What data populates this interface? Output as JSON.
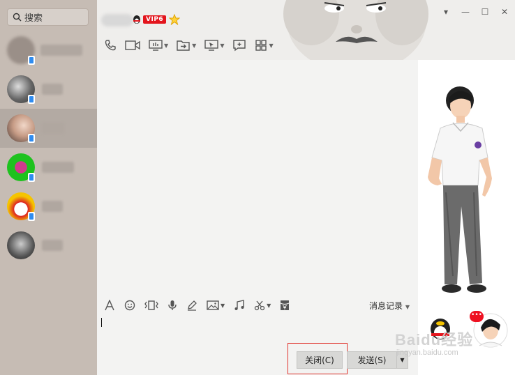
{
  "sidebar": {
    "search_placeholder": "搜索",
    "contacts": [
      {
        "active": false
      },
      {
        "active": false
      },
      {
        "active": true
      },
      {
        "active": false
      },
      {
        "active": false
      },
      {
        "active": false
      }
    ]
  },
  "header": {
    "vip_label": "VIP6",
    "toolbar_icons": [
      "phone-icon",
      "video-icon",
      "screen-share-icon",
      "file-transfer-icon",
      "remote-desktop-icon",
      "comment-icon",
      "apps-icon"
    ]
  },
  "window_controls": {
    "dropdown": "▾",
    "minimize": "—",
    "maximize": "☐",
    "close": "✕"
  },
  "input_toolbar": {
    "history_label": "消息记录",
    "icons": [
      "font-icon",
      "emoji-icon",
      "shake-icon",
      "voice-icon",
      "handwriting-icon",
      "image-icon",
      "music-icon",
      "scissors-icon",
      "red-packet-icon"
    ]
  },
  "buttons": {
    "close_label": "关闭(C)",
    "send_label": "发送(S)"
  },
  "watermark": {
    "main": "Baidu经验",
    "sub": "jingyan.baidu.com"
  },
  "colors": {
    "sidebar": "#c6bcb4",
    "accent_red": "#e0342e",
    "vip_red": "#e3151d"
  }
}
